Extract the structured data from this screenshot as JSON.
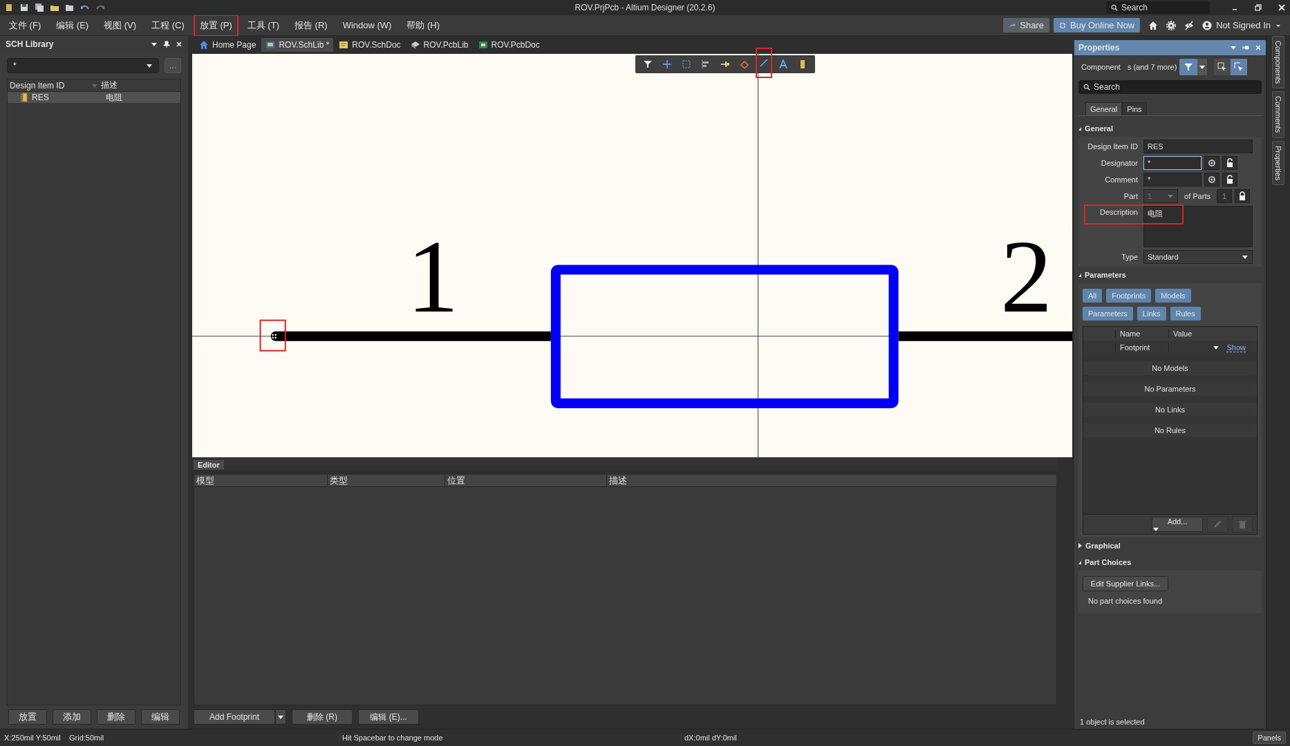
{
  "window": {
    "title": "ROV.PrjPcb - Altium Designer (20.2.6)",
    "search_placeholder": "Search"
  },
  "menu": [
    {
      "label": "文件 (F)",
      "highlighted": false
    },
    {
      "label": "编辑 (E)",
      "highlighted": false
    },
    {
      "label": "视图 (V)",
      "highlighted": false
    },
    {
      "label": "工程 (C)",
      "highlighted": false
    },
    {
      "label": "放置 (P)",
      "highlighted": true
    },
    {
      "label": "工具 (T)",
      "highlighted": false
    },
    {
      "label": "报告 (R)",
      "highlighted": false
    },
    {
      "label": "Window (W)",
      "highlighted": false
    },
    {
      "label": "帮助 (H)",
      "highlighted": false
    }
  ],
  "top_actions": {
    "share": "Share",
    "buy": "Buy Online Now",
    "account": "Not Signed In"
  },
  "left_panel": {
    "title": "SCH Library",
    "filter": "*",
    "filter_button": "...",
    "columns": [
      "Design Item ID",
      "描述"
    ],
    "rows": [
      {
        "id": "RES",
        "description": "电阻",
        "selected": true
      }
    ],
    "buttons": [
      "放置",
      "添加",
      "删除",
      "编辑"
    ]
  },
  "doc_tabs": [
    {
      "label": "Home Page",
      "kind": "home",
      "selected": false
    },
    {
      "label": "ROV.SchLib *",
      "kind": "schlib",
      "selected": true
    },
    {
      "label": "ROV.SchDoc",
      "kind": "schdoc",
      "selected": false
    },
    {
      "label": "ROV.PcbLib",
      "kind": "pcblib",
      "selected": false
    },
    {
      "label": "ROV.PcbDoc",
      "kind": "pcbdoc",
      "selected": false
    }
  ],
  "canvas_toolbar": [
    {
      "kind": "filter",
      "highlighted": false
    },
    {
      "kind": "cross",
      "highlighted": false
    },
    {
      "kind": "select",
      "highlighted": false
    },
    {
      "kind": "align",
      "highlighted": false
    },
    {
      "kind": "pin",
      "highlighted": false
    },
    {
      "kind": "eraser",
      "highlighted": false
    },
    {
      "kind": "line",
      "highlighted": true
    },
    {
      "kind": "text",
      "highlighted": false
    },
    {
      "kind": "part",
      "highlighted": false
    }
  ],
  "canvas": {
    "pin_numbers": [
      "1",
      "2"
    ],
    "pin_end_highlighted": true
  },
  "editor": {
    "tab": "Editor",
    "columns": [
      "模型",
      "类型",
      "位置",
      "描述"
    ],
    "buttons": [
      {
        "label": "Add Footprint",
        "kind": "split"
      },
      {
        "label": "删除 (R)",
        "kind": "delete"
      },
      {
        "label": "编辑 (E)...",
        "kind": "edit"
      }
    ]
  },
  "properties": {
    "title": "Properties",
    "filter_label": "Component",
    "filter_more": "s (and 7 more)",
    "search_placeholder": "Search",
    "tabs": [
      {
        "label": "General",
        "selected": true
      },
      {
        "label": "Pins",
        "selected": false
      }
    ],
    "general": {
      "title": "General",
      "expanded": true,
      "design_item_id": {
        "label": "Design Item ID",
        "value": "RES"
      },
      "designator": {
        "label": "Designator",
        "value": "*"
      },
      "comment": {
        "label": "Comment",
        "value": "*"
      },
      "part": {
        "label": "Part",
        "value": "1",
        "of_label": "of Parts",
        "of_value": "1"
      },
      "description": {
        "label": "Description",
        "value": "电阻",
        "highlighted": true
      },
      "type": {
        "label": "Type",
        "value": "Standard"
      }
    },
    "parameters": {
      "title": "Parameters",
      "expanded": true,
      "filters": [
        "All",
        "Footprints",
        "Models",
        "Parameters",
        "Links",
        "Rules"
      ],
      "columns": [
        "Name",
        "Value"
      ],
      "rows": [
        {
          "name": "Footprint",
          "action": "Show"
        }
      ],
      "empty": [
        "No Models",
        "No Parameters",
        "No Links",
        "No Rules"
      ],
      "add_button": "Add..."
    },
    "graphical": {
      "title": "Graphical",
      "expanded": false
    },
    "part_choices": {
      "title": "Part Choices",
      "expanded": true,
      "button": "Edit Supplier Links...",
      "message": "No part choices found"
    },
    "status": "1 object is selected"
  },
  "side_tabs": [
    "Components",
    "Comments",
    "Properties"
  ],
  "status_bar": {
    "position": "X:250mil Y:50mil",
    "grid": "Grid:50mil",
    "hint": "Hit Spacebar to change mode",
    "delta": "dX:0mil dY:0mil",
    "panels": "Panels"
  }
}
